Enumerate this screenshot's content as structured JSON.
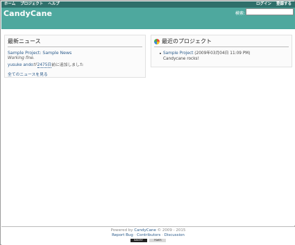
{
  "top_menu": {
    "home": "ホーム",
    "projects": "プロジェクト",
    "help": "ヘルプ",
    "login": "ログイン",
    "register": "登録する"
  },
  "header": {
    "title": "CandyCane",
    "search_label": "検索:",
    "search_value": ""
  },
  "news": {
    "heading": "最新ニュース",
    "item_title": "Sample Project: Sample News",
    "item_summary": "Working fine.",
    "author": "yusuke ando",
    "author_mid": "が",
    "time_ago": "2475日",
    "author_suffix": "前に追加しました",
    "all_news": "全てのニュースを見る"
  },
  "projects": {
    "heading": "最近のプロジェクト",
    "items": [
      {
        "name": "Sample Project",
        "date": "(2009年03月04日 11:09 PM)",
        "description": "Candycane rocks!"
      }
    ]
  },
  "footer": {
    "powered_by": "Powered by",
    "product": "CandyCane",
    "years": "© 2009 - 2015",
    "report_bug": "Report Bug",
    "sep1": "·",
    "contributors": "Contributors",
    "sep2": "·",
    "discussion": "Discussion",
    "badge1": "BAKERY",
    "badge2": "POWER"
  }
}
